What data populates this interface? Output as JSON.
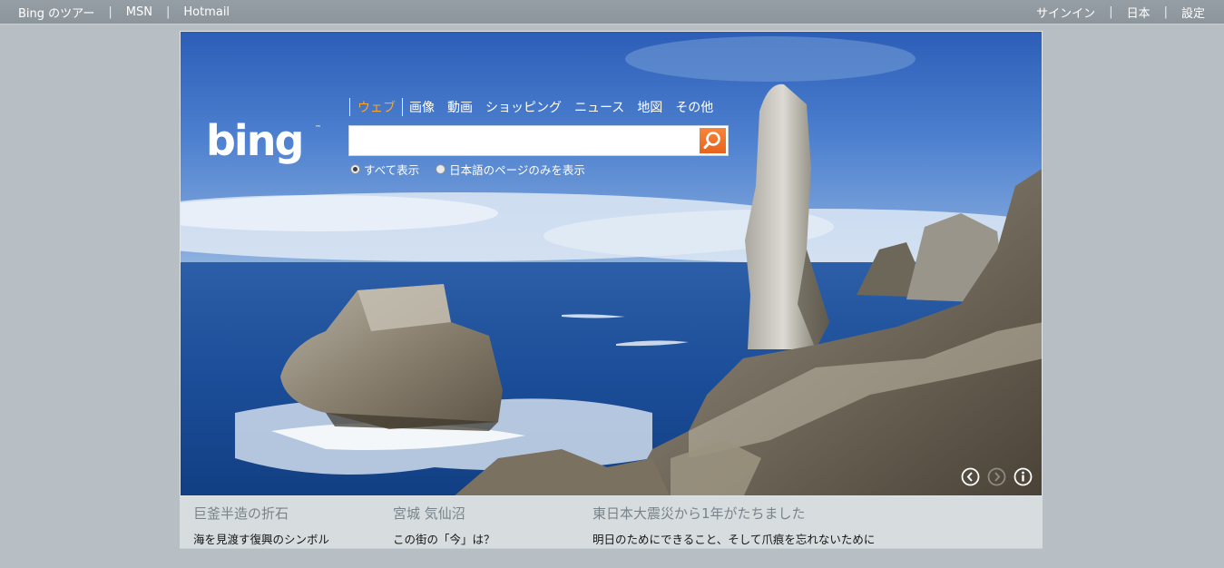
{
  "topbar": {
    "left_links": [
      "Bing のツアー",
      "MSN",
      "Hotmail"
    ],
    "right_links": [
      "サインイン",
      "日本",
      "設定"
    ],
    "separator": "|"
  },
  "logo": {
    "text": "bing",
    "tm": "™"
  },
  "verticals": [
    "ウェブ",
    "画像",
    "動画",
    "ショッピング",
    "ニュース",
    "地図",
    "その他"
  ],
  "search": {
    "value": "",
    "placeholder": "",
    "icon": "search-icon"
  },
  "scope": {
    "options": [
      "すべて表示",
      "日本語のページのみを表示"
    ],
    "selected": "すべて表示"
  },
  "hero_controls": [
    "previous-icon",
    "next-icon",
    "info-icon"
  ],
  "captions": [
    {
      "title": "巨釜半造の折石",
      "subtitle": "海を見渡す復興のシンボル"
    },
    {
      "title": "宮城 気仙沼",
      "subtitle": "この街の「今」は？"
    },
    {
      "title": "東日本大震災から1年がたちました",
      "subtitle": "明日のためにできること、そして爪痕を忘れないために"
    }
  ],
  "colors": {
    "accent": "#f7a630",
    "search_button": "#e7631d",
    "page_background": "#b7bfc4"
  }
}
